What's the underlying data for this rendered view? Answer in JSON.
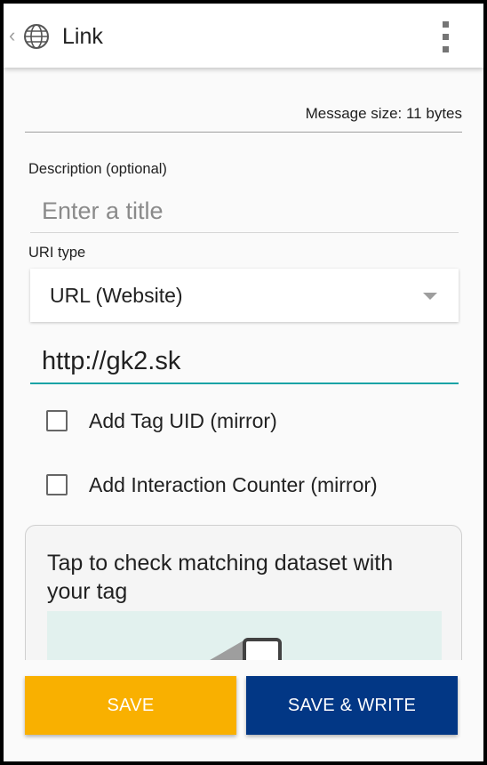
{
  "app_bar": {
    "title": "Link",
    "icon": "globe-icon",
    "menu_icon": "overflow-menu-icon"
  },
  "message_size": "Message size: 11 bytes",
  "description": {
    "label": "Description (optional)",
    "placeholder": "Enter a title",
    "value": ""
  },
  "uri_type": {
    "label": "URI type",
    "selected": "URL (Website)"
  },
  "url_field": {
    "value": "http://gk2.sk"
  },
  "options": [
    {
      "label": "Add Tag UID (mirror)",
      "checked": false
    },
    {
      "label": "Add Interaction Counter (mirror)",
      "checked": false
    }
  ],
  "card": {
    "text": "Tap to check matching dataset with your tag"
  },
  "buttons": {
    "save": "SAVE",
    "save_write": "SAVE & WRITE"
  },
  "colors": {
    "accent": "#1aa3a6",
    "save": "#f9b000",
    "save_write": "#023785"
  }
}
